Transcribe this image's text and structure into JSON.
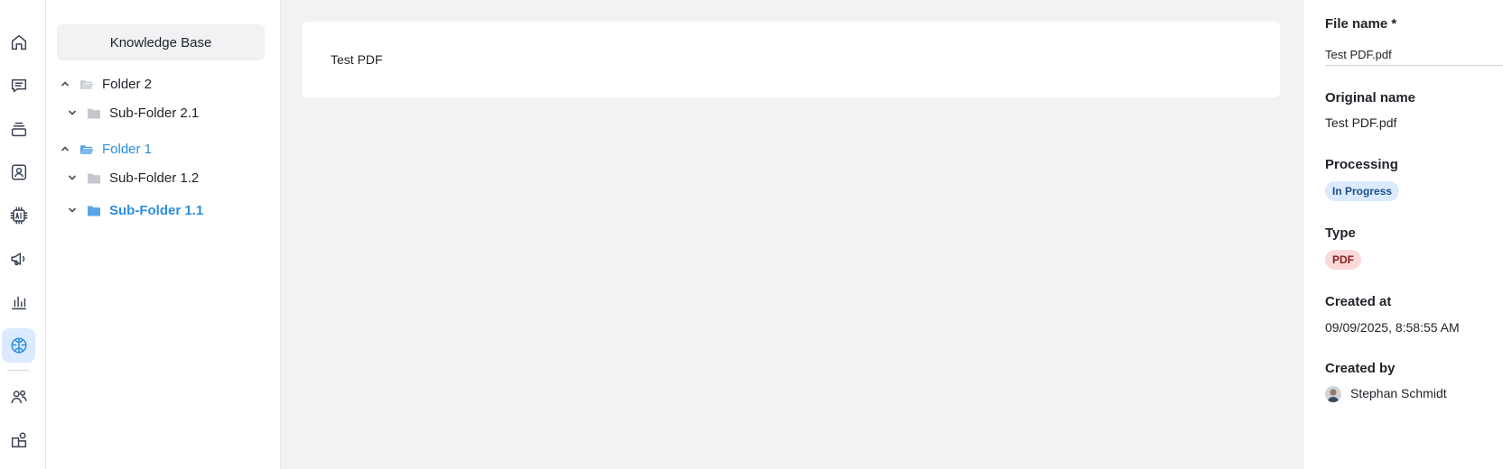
{
  "nav_rail": {
    "items": [
      {
        "icon": "home-icon"
      },
      {
        "icon": "chat-icon"
      },
      {
        "icon": "stack-icon"
      },
      {
        "icon": "contact-icon"
      },
      {
        "icon": "ai-chip-icon"
      },
      {
        "icon": "megaphone-icon"
      },
      {
        "icon": "bar-chart-icon"
      },
      {
        "icon": "brain-icon",
        "active": true
      },
      {
        "icon": "users-icon"
      },
      {
        "icon": "integrations-icon"
      }
    ]
  },
  "tree": {
    "header_button": "Knowledge Base",
    "nodes": [
      {
        "label": "Folder 2",
        "expanded": true,
        "level": 0
      },
      {
        "label": "Sub-Folder 2.1",
        "expanded": false,
        "level": 1
      },
      {
        "label": "Folder 1",
        "expanded": true,
        "level": 0,
        "selected": true
      },
      {
        "label": "Sub-Folder 1.2",
        "expanded": false,
        "level": 1
      },
      {
        "label": "Sub-Folder 1.1",
        "expanded": false,
        "level": 1,
        "selected": true
      }
    ]
  },
  "main": {
    "document_title": "Test PDF"
  },
  "details": {
    "file_name_label": "File name *",
    "file_name_value": "Test PDF.pdf",
    "original_name_label": "Original name",
    "original_name_value": "Test PDF.pdf",
    "processing_label": "Processing",
    "processing_value": "In Progress",
    "type_label": "Type",
    "type_value": "PDF",
    "created_at_label": "Created at",
    "created_at_value": "09/09/2025, 8:58:55 AM",
    "created_by_label": "Created by",
    "created_by_value": "Stephan Schmidt"
  },
  "colors": {
    "accent": "#2b8ee0",
    "active_bg": "#dbeafe",
    "main_bg": "#f1f2f4",
    "chip_blue_bg": "#dbeafe",
    "chip_red_bg": "#fbd9d9"
  }
}
